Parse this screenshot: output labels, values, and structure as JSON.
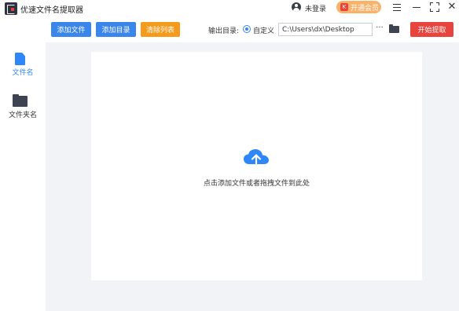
{
  "titlebar": {
    "app_title": "优速文件名提取器",
    "login_text": "未登录",
    "vip_label": "开通会员",
    "vip_icon_text": "K",
    "colors": {
      "vip_bg": "#f8b26a",
      "vip_icon": "#e8433c"
    }
  },
  "sidebar": {
    "items": [
      {
        "label": "文件名",
        "icon": "file-icon",
        "active": true
      },
      {
        "label": "文件夹名",
        "icon": "folder-icon",
        "active": false
      }
    ]
  },
  "toolbar": {
    "add_file_label": "添加文件",
    "add_dir_label": "添加目录",
    "clear_label": "清除列表",
    "output_dir_label": "输出目录:",
    "custom_option_label": "自定义",
    "path_value": "C:\\Users\\dx\\Desktop",
    "more_label": "···",
    "start_label": "开始提取",
    "colors": {
      "blue": "#3a86ea",
      "orange": "#f49a1c",
      "red": "#e8433c"
    }
  },
  "drop_area": {
    "hint": "点击添加文件或者拖拽文件到此处",
    "icon": "cloud-upload-icon",
    "color": "#2f86f6"
  }
}
